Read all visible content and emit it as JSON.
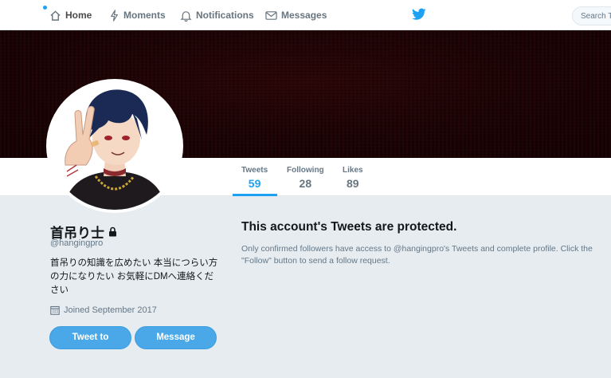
{
  "nav": {
    "home_label": "Home",
    "moments_label": "Moments",
    "notifications_label": "Notifications",
    "messages_label": "Messages",
    "search_placeholder": "Search Twitter"
  },
  "stats": {
    "tweets_label": "Tweets",
    "tweets_value": "59",
    "following_label": "Following",
    "following_value": "28",
    "likes_label": "Likes",
    "likes_value": "89"
  },
  "profile": {
    "name": "首吊り士",
    "handle": "@hangingpro",
    "bio": "首吊りの知識を広めたい 本当につらい方の力になりたい お気軽にDMへ連絡ください",
    "joined": "Joined September 2017",
    "tweet_to_label": "Tweet to",
    "message_label": "Message"
  },
  "protected": {
    "title": "This account's Tweets are protected.",
    "body": "Only confirmed followers have access to @hangingpro's Tweets and complete profile. Click the \"Follow\" button to send a follow request."
  },
  "colors": {
    "accent": "#1da1f2",
    "button": "#4aa8e8",
    "background": "#e6ecf0",
    "banner": "#1c0405"
  },
  "icons": [
    "home-icon",
    "lightning-icon",
    "bell-icon",
    "envelope-icon",
    "twitter-bird-icon",
    "lock-icon",
    "calendar-icon"
  ]
}
